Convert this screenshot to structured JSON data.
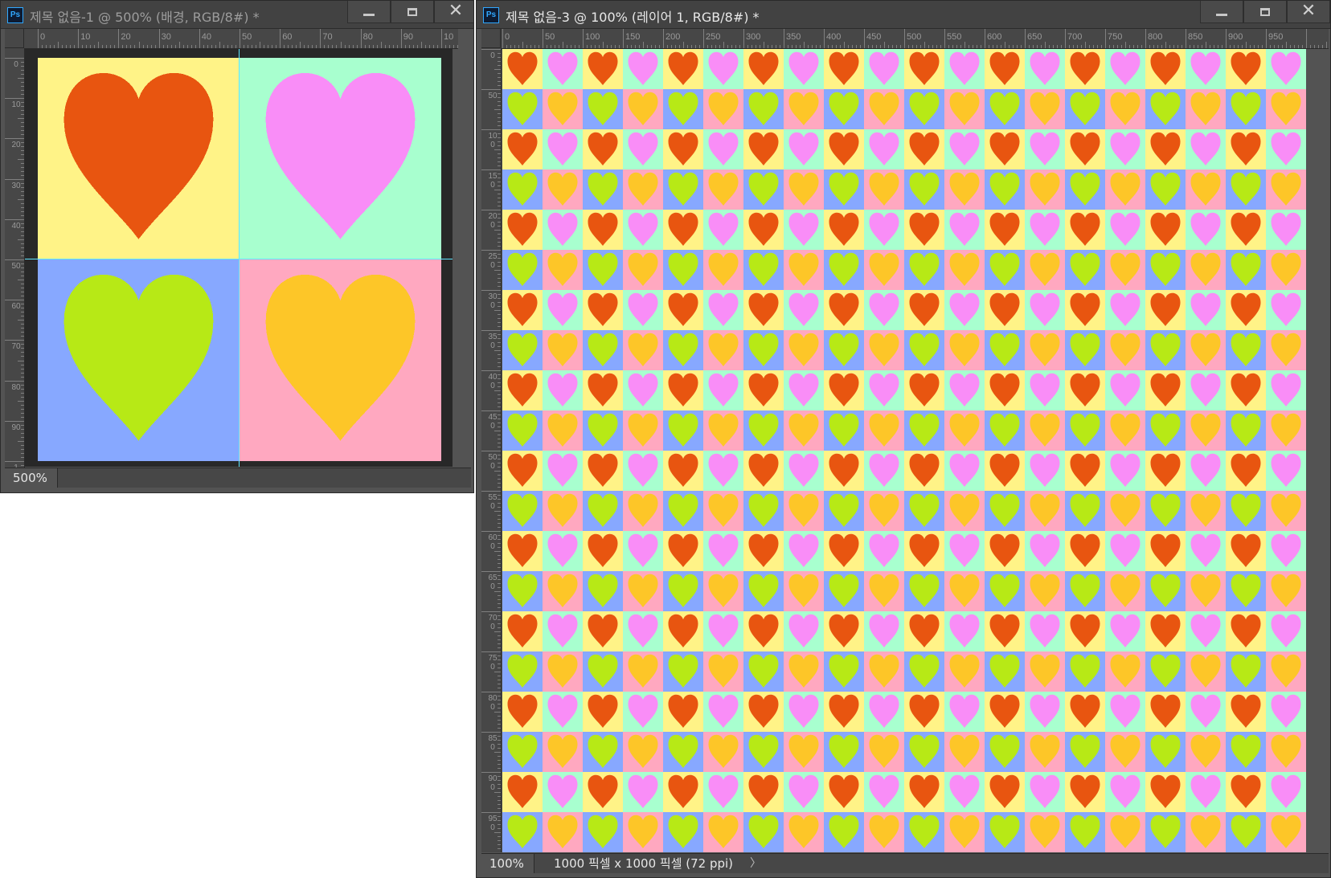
{
  "colors": {
    "yellow": "#fff387",
    "mint": "#a8ffcf",
    "blue": "#87a8ff",
    "pink": "#ffa8c0",
    "orange_heart": "#e85510",
    "violet_heart": "#f98df7",
    "lime_heart": "#b7e916",
    "gold_heart": "#fdc628",
    "guide": "#5ee7ff",
    "pasteboard": "#282828"
  },
  "window1": {
    "app_icon": "Ps",
    "title": "제목 없음-1 @ 500% (배경, RGB/8#) *",
    "state": "inactive",
    "ruler_h_labels": [
      "0",
      "10",
      "20",
      "30",
      "40",
      "50",
      "60",
      "70",
      "80",
      "90",
      "10"
    ],
    "ruler_v_labels": [
      "0",
      "10",
      "20",
      "30",
      "40",
      "50",
      "60",
      "70",
      "80",
      "90",
      "1"
    ],
    "zoom": "500%",
    "tiles": [
      {
        "bg": "yellow",
        "heart": "orange_heart"
      },
      {
        "bg": "mint",
        "heart": "violet_heart"
      },
      {
        "bg": "blue",
        "heart": "lime_heart"
      },
      {
        "bg": "pink",
        "heart": "gold_heart"
      }
    ]
  },
  "window2": {
    "app_icon": "Ps",
    "title": "제목 없음-3 @ 100% (레이어 1, RGB/8#) *",
    "state": "active",
    "ruler_h_labels": [
      "0",
      "50",
      "100",
      "150",
      "200",
      "250",
      "300",
      "350",
      "400",
      "450",
      "500",
      "550",
      "600",
      "650",
      "700",
      "750",
      "800",
      "850",
      "900",
      "950"
    ],
    "ruler_v_labels": [
      "0",
      "50",
      "100",
      "150",
      "200",
      "250",
      "300",
      "350",
      "400",
      "450",
      "500",
      "550",
      "600",
      "650",
      "700",
      "750",
      "800",
      "850",
      "900",
      "950"
    ],
    "zoom": "100%",
    "doc_info": "1000 픽셀 x 1000 픽셀 (72 ppi)",
    "status_arrow": "〉",
    "pattern": {
      "cols": 20,
      "rows": 20
    }
  }
}
